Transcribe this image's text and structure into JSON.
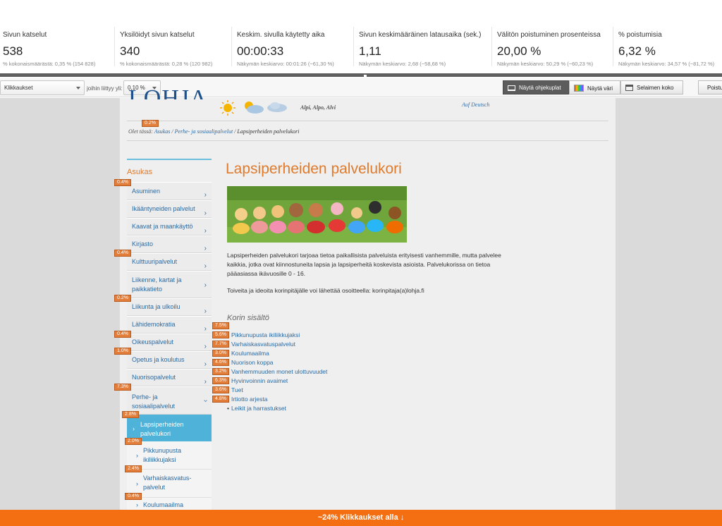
{
  "metrics": [
    {
      "label": "Sivun katselut",
      "value": "538",
      "sub": "% kokonaismäärästä: 0,35 % (154 828)"
    },
    {
      "label": "Yksilöidyt sivun katselut",
      "value": "340",
      "sub": "% kokonaismäärästä: 0,28 % (120 982)"
    },
    {
      "label": "Keskim. sivulla käytetty aika",
      "value": "00:00:33",
      "sub": "Näkymän keskiarvo: 00:01:26 (−61,30 %)"
    },
    {
      "label": "Sivun keskimääräinen latausaika (sek.)",
      "value": "1,11",
      "sub": "Näkymän keskiarvo: 2,68 (−58,68 %)"
    },
    {
      "label": "Välitön poistuminen prosenteissa",
      "value": "20,00 %",
      "sub": "Näkymän keskiarvo: 50,29 % (−60,23 %)"
    },
    {
      "label": "% poistumisia",
      "value": "6,32 %",
      "sub": "Näkymän keskiarvo: 34,57 % (−81,72 %)"
    }
  ],
  "toolbar": {
    "metric_select": "Klikkaukset",
    "threshold_label": "joihin liittyy yli:",
    "threshold_select": "0,10 %",
    "show_bubbles": "Näytä ohjekuplat",
    "show_color": "Näytä väri",
    "browser_size": "Selaimen koko",
    "cut_button": "Poistu"
  },
  "site": {
    "logo": "LOHJA",
    "names": "Alpi, Alpo, Alvi",
    "deutsch": "Auf Deutsch",
    "crumb_prefix": "Olet tässä:",
    "crumb_1": "Asukas",
    "crumb_2": "Perhe- ja sosiaalipalvelut",
    "crumb_current": "Lapsiperheiden palvelukori",
    "crumb_sep": "/"
  },
  "sidebar": {
    "title": "Asukas",
    "items": [
      {
        "label": "Asuminen"
      },
      {
        "label": "Ikääntyneiden palvelut"
      },
      {
        "label": "Kaavat ja maankäyttö"
      },
      {
        "label": "Kirjasto"
      },
      {
        "label": "Kulttuuripalvelut"
      },
      {
        "label": "Liikenne, kartat ja paikkatieto"
      },
      {
        "label": "Liikunta ja ulkoilu"
      },
      {
        "label": "Lähidemokratia"
      },
      {
        "label": "Oikeuspalvelut"
      },
      {
        "label": "Opetus ja koulutus"
      },
      {
        "label": "Nuorisopalvelut"
      },
      {
        "label": "Perhe- ja sosiaalipalvelut"
      }
    ],
    "active": "Lapsiperheiden palvelukori",
    "sub": [
      {
        "label": "Pikkunupusta ikiliikkujaksi"
      },
      {
        "label": "Varhaiskasvatus-palvelut"
      },
      {
        "label": "Koulumaailma"
      }
    ]
  },
  "main": {
    "title": "Lapsiperheiden palvelukori",
    "intro": "Lapsiperheiden palvelukori tarjoaa tietoa paikallisista palveluista erityisesti vanhemmille, mutta palvelee kaikkia, jotka ovat kiinnostuneita lapsia ja lapsiperheitä koskevista asioista. Palvelukorissa on tietoa pääasiassa ikävuosille 0 - 16.",
    "contact": "Toiveita ja ideoita korinpitäjälle voi lähettää osoitteella: korinpitaja(a)lohja.fi",
    "basket_heading": "Korin sisältö",
    "links": [
      "Pikkunupusta ikiliikkujaksi",
      "Varhaiskasvatuspalvelut",
      "Koulumaailma",
      "Nuorison koppa",
      "Vanhemmuuden monet ulottuvuudet",
      "Hyvinvoinnin avaimet",
      "Tuet",
      "Irtiotto arjesta",
      "Leikit ja harrastukset"
    ]
  },
  "overlays": {
    "crumb": "0.2%",
    "asuminen": "0.4%",
    "kulttuuri": "0.4%",
    "liikunta": "0.2%",
    "oikeus": "0.4%",
    "opetus": "1.0%",
    "perhe": "7.3%",
    "lapsi": "2.8%",
    "pikkunupusta": "2.0%",
    "varhais": "2.4%",
    "koulu": "0.4%",
    "links": [
      "7.5%",
      "5.6%",
      "7.7%",
      "3.0%",
      "4.6%",
      "3.2%",
      "6.3%",
      "3.6%",
      "4.8%"
    ]
  },
  "colors": {
    "accent": "#e07b2d",
    "link": "#2b6aa3",
    "active_nav": "#4fb3d9",
    "overlay": "#e37e3a",
    "bottom_bar": "#f46e12"
  },
  "bottom_bar": "~24% Klikkaukset alla ↓"
}
